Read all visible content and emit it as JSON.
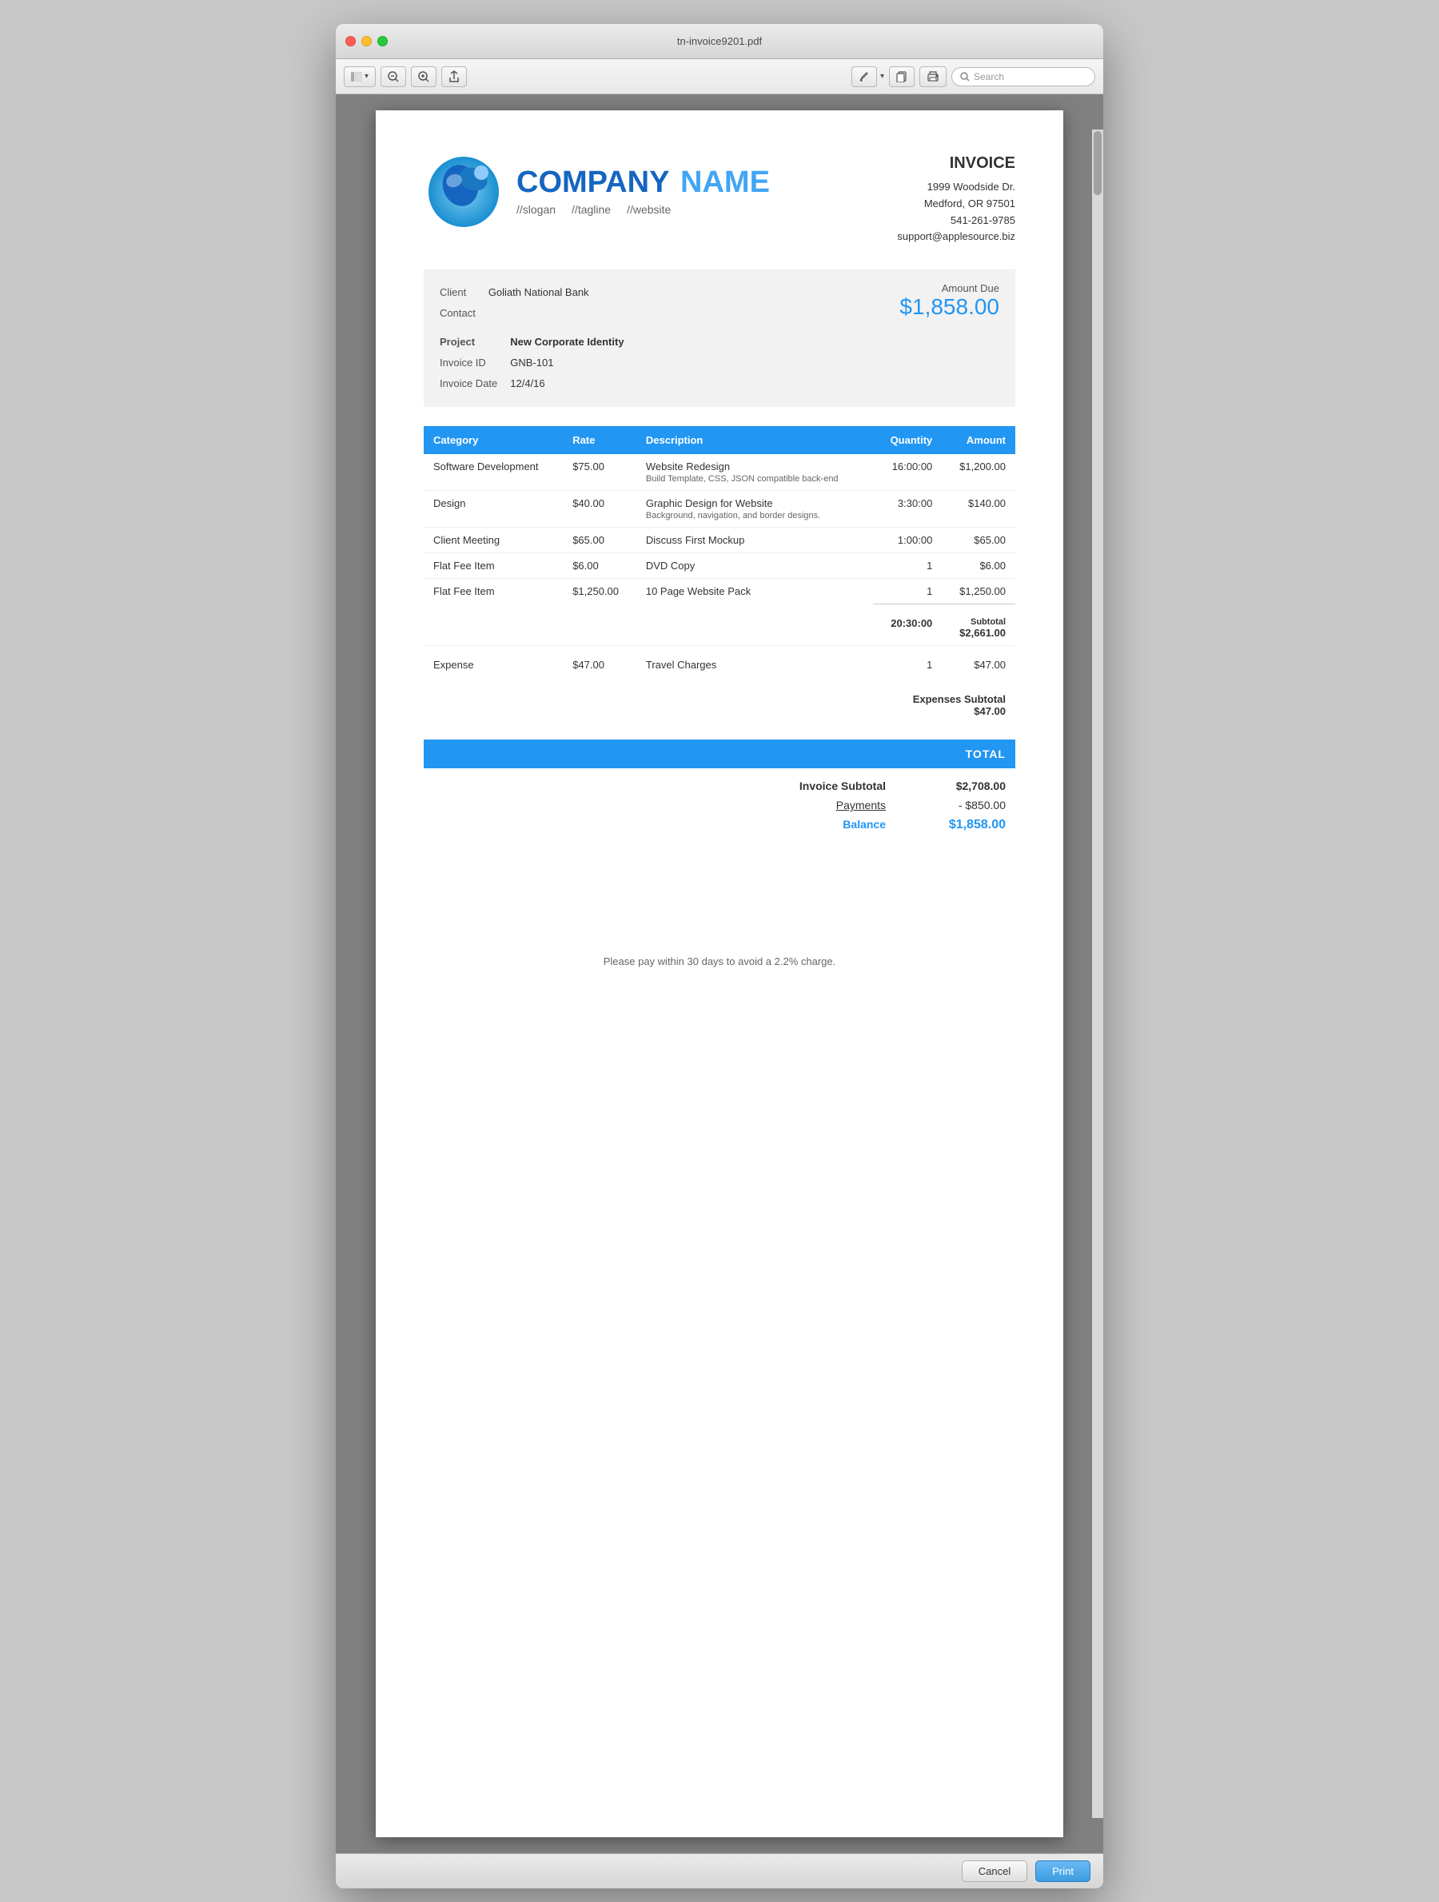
{
  "window": {
    "title": "tn-invoice9201.pdf"
  },
  "toolbar": {
    "search_placeholder": "Search"
  },
  "company": {
    "name_part1": "COMPANY",
    "name_part2": "NAME",
    "slogan": "//slogan",
    "tagline": "//tagline",
    "website": "//website"
  },
  "invoice_address": {
    "label": "INVOICE",
    "line1": "1999 Woodside Dr.",
    "line2": "Medford, OR 97501",
    "phone": "541-261-9785",
    "email": "support@applesource.biz"
  },
  "client": {
    "name_label": "Client",
    "contact_label": "Contact",
    "name_value": "Goliath National Bank",
    "contact_value": "",
    "project_label": "Project",
    "invoice_id_label": "Invoice ID",
    "invoice_date_label": "Invoice Date",
    "project_value": "New Corporate Identity",
    "invoice_id_value": "GNB-101",
    "invoice_date_value": "12/4/16",
    "amount_due_label": "Amount Due",
    "amount_due_value": "$1,858.00"
  },
  "table": {
    "headers": {
      "category": "Category",
      "rate": "Rate",
      "description": "Description",
      "quantity": "Quantity",
      "amount": "Amount"
    },
    "rows": [
      {
        "category": "Software Development",
        "rate": "$75.00",
        "description": "Website Redesign",
        "description_sub": "Build Template, CSS, JSON compatible back-end",
        "quantity": "16:00:00",
        "amount": "$1,200.00"
      },
      {
        "category": "Design",
        "rate": "$40.00",
        "description": "Graphic Design for Website",
        "description_sub": "Background, navigation, and border designs.",
        "quantity": "3:30:00",
        "amount": "$140.00"
      },
      {
        "category": "Client Meeting",
        "rate": "$65.00",
        "description": "Discuss First Mockup",
        "description_sub": "",
        "quantity": "1:00:00",
        "amount": "$65.00"
      },
      {
        "category": "Flat Fee Item",
        "rate": "$6.00",
        "description": "DVD Copy",
        "description_sub": "",
        "quantity": "1",
        "amount": "$6.00"
      },
      {
        "category": "Flat Fee Item",
        "rate": "$1,250.00",
        "description": "10 Page Website Pack",
        "description_sub": "",
        "quantity": "1",
        "amount": "$1,250.00"
      }
    ],
    "subtotal_quantity": "20:30:00",
    "subtotal_label": "Subtotal",
    "subtotal_value": "$2,661.00",
    "expense_row": {
      "category": "Expense",
      "rate": "$47.00",
      "description": "Travel Charges",
      "quantity": "1",
      "amount": "$47.00"
    },
    "expenses_subtotal_label": "Expenses Subtotal",
    "expenses_subtotal_value": "$47.00"
  },
  "totals": {
    "header_label": "TOTAL",
    "invoice_subtotal_label": "Invoice Subtotal",
    "invoice_subtotal_value": "$2,708.00",
    "payments_label": "Payments",
    "payments_value": "- $850.00",
    "balance_label": "Balance",
    "balance_value": "$1,858.00"
  },
  "footer": {
    "note": "Please pay within 30 days to avoid a 2.2% charge."
  },
  "bottom_buttons": {
    "cancel": "Cancel",
    "print": "Print"
  }
}
